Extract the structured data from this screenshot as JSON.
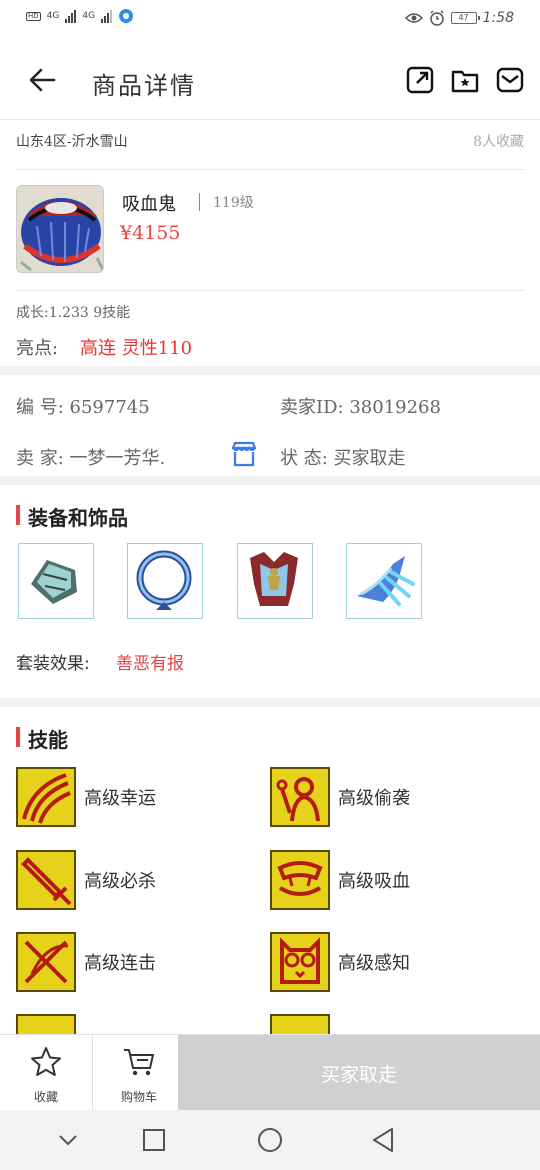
{
  "status_bar": {
    "network_1": "4G",
    "network_2": "4G",
    "battery": "47",
    "time": "1:58"
  },
  "header": {
    "title": "商品详情",
    "icons": [
      "back-arrow-icon",
      "share-icon",
      "favorite-folder-icon",
      "message-icon"
    ]
  },
  "product": {
    "server": "山东4区-沂水雪山",
    "favorites": "8人收藏",
    "name": "吸血鬼",
    "level": "119级",
    "price": "¥4155",
    "growth": "成长:1.233  9技能",
    "highlight_label": "亮点:",
    "highlight_value": "高连 灵性110"
  },
  "details": {
    "id_label": "编   号:",
    "id_value": "6597745",
    "seller_id_label": "卖家ID:",
    "seller_id_value": "38019268",
    "seller_label": "卖   家:",
    "seller_value": "一梦一芳华.",
    "status_label": "状   态:",
    "status_value": "买家取走"
  },
  "equipment": {
    "title": "装备和饰品",
    "items": [
      "bracer-icon",
      "ring-icon",
      "armor-icon",
      "claw-icon"
    ],
    "suit_label": "套装效果:",
    "suit_value": "善恶有报"
  },
  "skills": {
    "title": "技能",
    "items": [
      {
        "label": "高级幸运",
        "icon": "luck-icon"
      },
      {
        "label": "高级偷袭",
        "icon": "sneak-icon"
      },
      {
        "label": "高级必杀",
        "icon": "sword-icon"
      },
      {
        "label": "高级吸血",
        "icon": "fang-icon"
      },
      {
        "label": "高级连击",
        "icon": "combo-icon"
      },
      {
        "label": "高级感知",
        "icon": "owl-icon"
      }
    ]
  },
  "bottom_bar": {
    "favorite_label": "收藏",
    "cart_label": "购物车",
    "buy_label": "买家取走"
  },
  "colors": {
    "accent_red": "#e64545",
    "price_red": "#ee4444",
    "skill_yellow": "#e6d21a"
  }
}
